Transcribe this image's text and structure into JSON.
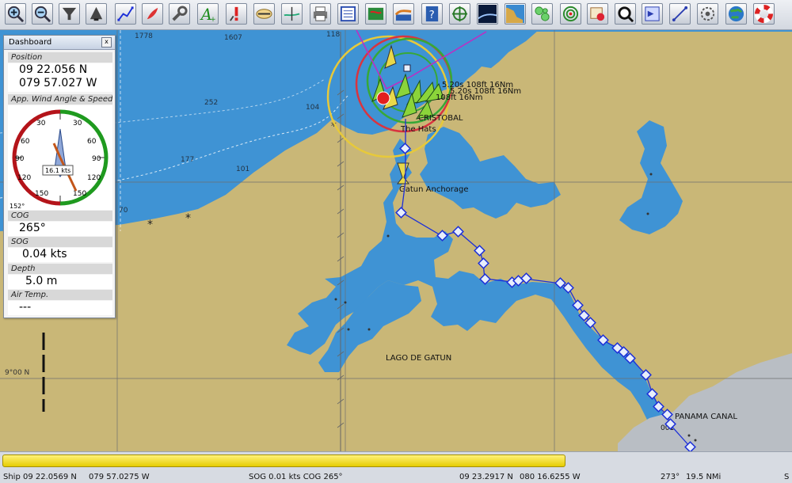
{
  "toolbar": {
    "buttons": [
      "zoom-in",
      "zoom-out",
      "scale-in",
      "scale-out",
      "route",
      "track",
      "settings",
      "text",
      "alert",
      "compass",
      "level",
      "print",
      "log",
      "book",
      "tide",
      "help",
      "crosshair",
      "satellite",
      "map",
      "grid",
      "radar",
      "layers",
      "zoom",
      "show",
      "ruler",
      "tide-station",
      "globe",
      "lifebuoy"
    ]
  },
  "dashboard": {
    "title": "Dashboard",
    "close_label": "x",
    "position_label": "Position",
    "lat": "09 22.056 N",
    "lon": "079 57.027 W",
    "wind_label": "App. Wind Angle & Speed",
    "wind_speed": "16.1 kts",
    "wind_angle": "152°",
    "gauge_ticks": [
      "30",
      "60",
      "90",
      "120",
      "150",
      "30",
      "60",
      "90",
      "120",
      "150"
    ],
    "cog_label": "COG",
    "cog": "265°",
    "sog_label": "SOG",
    "sog": "0.04 kts",
    "depth_label": "Depth",
    "depth": "5.0 m",
    "air_label": "Air Temp.",
    "air": "---"
  },
  "chart": {
    "soundings": [
      "1778",
      "1607",
      "118",
      "252",
      "177",
      "101",
      "104",
      "70"
    ],
    "labels": {
      "cristobal": "CRISTOBAL",
      "hats": "The Hats",
      "anchorage": "Gatun Anchorage",
      "lago": "LAGO DE GATUN",
      "panama": "PANAMA CANAL",
      "wp": "001",
      "lat9": "9°00 N",
      "ais": "5.20s 108ft 16Nm",
      "ais2": "5.20s 108ft 16Nm",
      "ais3": "108ft 16Nm"
    },
    "colors": {
      "water": "#3f93d4",
      "land": "#c9b777",
      "route": "#1c2fd8",
      "ring_green": "#37a837",
      "ring_red": "#d9343f",
      "ring_yellow": "#e7c93a"
    }
  },
  "status": {
    "progress": 0.715,
    "ship": "Ship 09 22.0569 N",
    "ship_lon": "079 57.0275 W",
    "sog_cog": "SOG 0.01 kts  COG 265°",
    "cursor_lat": "09 23.2917 N",
    "cursor_lon": "080 16.6255 W",
    "bearing": "273°",
    "distance": "19.5 NMi",
    "extra": "S"
  }
}
